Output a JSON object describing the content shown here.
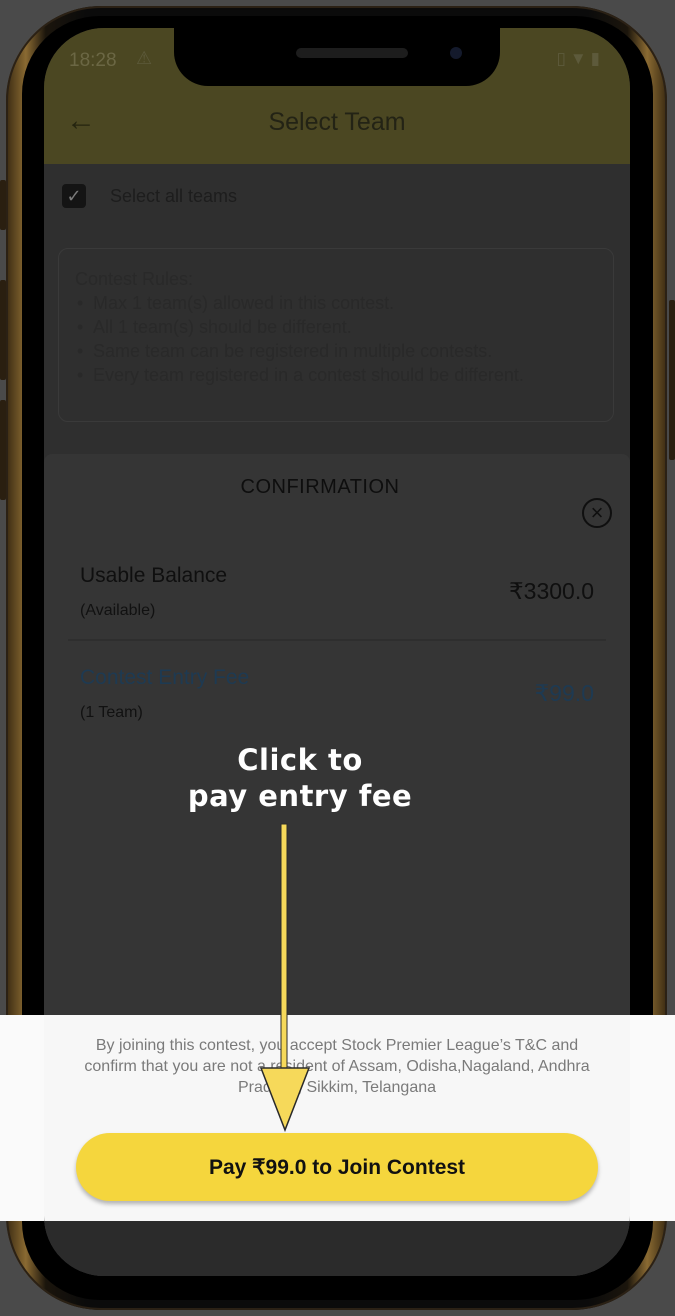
{
  "status_bar": {
    "time": "18:28",
    "warning_icon": "warning-icon",
    "right_icons": [
      "vibrate-icon",
      "wifi-icon",
      "battery-icon"
    ]
  },
  "app_bar": {
    "title": "Select Team",
    "back_icon": "back-arrow-icon"
  },
  "select_all": {
    "checked": true,
    "label": "Select all teams"
  },
  "contest_rules": {
    "title": "Contest Rules:",
    "items": [
      "Max 1 team(s) allowed in this contest.",
      "All 1 team(s) should be different.",
      "Same team can be registered in multiple contests.",
      "Every team registered in a contest should be different."
    ]
  },
  "confirmation": {
    "title": "CONFIRMATION",
    "close_icon": "close-circle-icon",
    "balance": {
      "label": "Usable Balance",
      "sub": "(Available)",
      "value": "₹3300.0"
    },
    "entry_fee": {
      "label": "Contest Entry Fee",
      "sub": "(1 Team)",
      "value": "₹99.0"
    }
  },
  "footer": {
    "terms": "By joining this contest, you accept Stock Premier League’s T&C and confirm that you are not a resident of Assam, Odisha,Nagaland, Andhra Pradesh, Sikkim, Telangana",
    "pay_button": "Pay ₹99.0 to Join Contest"
  },
  "annotation": {
    "line1": "Click to",
    "line2": "pay entry fee"
  },
  "colors": {
    "accent_yellow": "#f5d63d",
    "annotation_arrow": "#f6d95a",
    "fee_blue": "#1e3a52",
    "overlay": "#2f2f2f"
  }
}
